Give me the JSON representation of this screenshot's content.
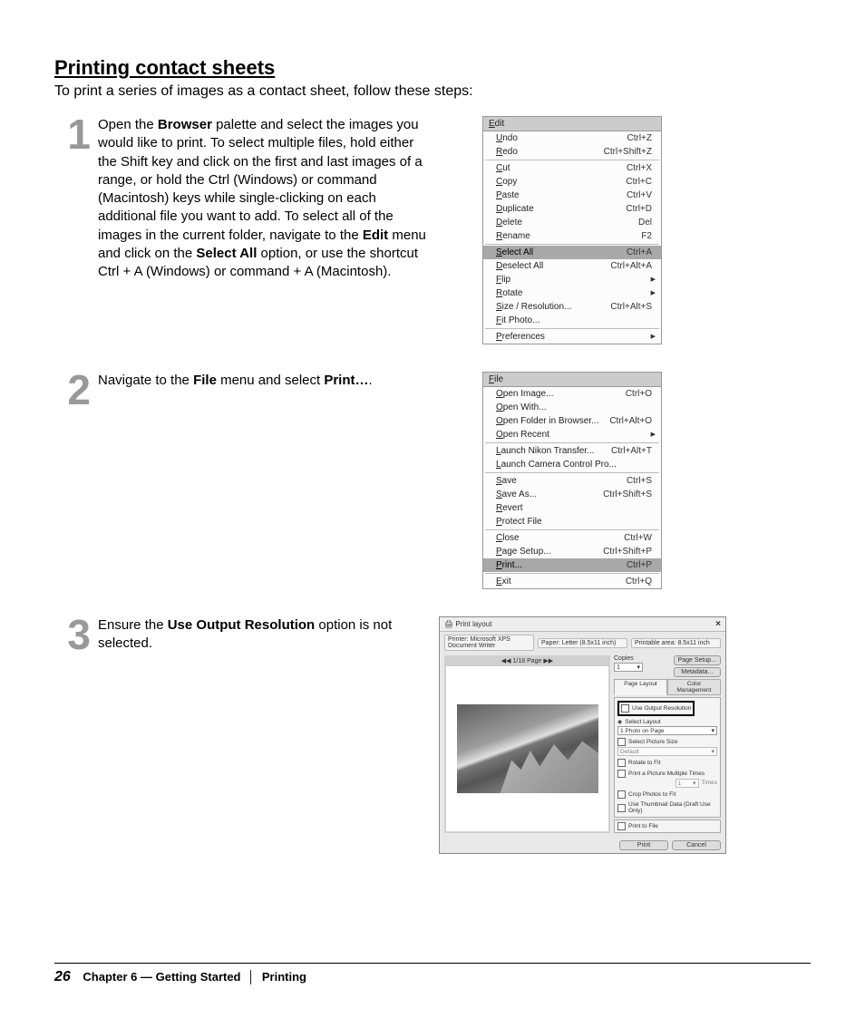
{
  "heading": "Printing contact sheets",
  "intro": "To print a series of images as a contact sheet, follow these steps:",
  "steps": {
    "s1": {
      "num": "1",
      "t1": "Open the ",
      "b1": "Browser",
      "t2": " palette and select the images you would like to print. To select multiple files, hold either the Shift key and click on the first and last images of a range, or hold the Ctrl (Windows) or command (Macintosh) keys while single-clicking on each additional file you want to add. To select all of the images in the current folder, navigate to the ",
      "b2": "Edit",
      "t3": " menu and click on the ",
      "b3": "Select All",
      "t4": " option, or use the shortcut Ctrl + A (Windows) or command + A (Macintosh)."
    },
    "s2": {
      "num": "2",
      "t1": "Navigate to the ",
      "b1": "File",
      "t2": " menu and select ",
      "b2": "Print…",
      "t3": "."
    },
    "s3": {
      "num": "3",
      "t1": "Ensure the ",
      "b1": "Use Output Resolution",
      "t2": " option is not selected."
    }
  },
  "editMenu": {
    "title": "Edit",
    "items": [
      {
        "l": "Undo",
        "s": "Ctrl+Z"
      },
      {
        "l": "Redo",
        "s": "Ctrl+Shift+Z"
      },
      {
        "sep": true
      },
      {
        "l": "Cut",
        "s": "Ctrl+X"
      },
      {
        "l": "Copy",
        "s": "Ctrl+C"
      },
      {
        "l": "Paste",
        "s": "Ctrl+V"
      },
      {
        "l": "Duplicate",
        "s": "Ctrl+D"
      },
      {
        "l": "Delete",
        "s": "Del"
      },
      {
        "l": "Rename",
        "s": "F2"
      },
      {
        "sep": true
      },
      {
        "l": "Select All",
        "s": "Ctrl+A",
        "hl": true
      },
      {
        "l": "Deselect All",
        "s": "Ctrl+Alt+A"
      },
      {
        "l": "Flip",
        "sub": true
      },
      {
        "l": "Rotate",
        "sub": true
      },
      {
        "l": "Size / Resolution...",
        "s": "Ctrl+Alt+S"
      },
      {
        "l": "Fit Photo..."
      },
      {
        "sep": true
      },
      {
        "l": "Preferences",
        "sub": true
      }
    ]
  },
  "fileMenu": {
    "title": "File",
    "items": [
      {
        "l": "Open Image...",
        "s": "Ctrl+O"
      },
      {
        "l": "Open With..."
      },
      {
        "l": "Open Folder in Browser...",
        "s": "Ctrl+Alt+O"
      },
      {
        "l": "Open Recent",
        "sub": true
      },
      {
        "sep": true
      },
      {
        "l": "Launch Nikon Transfer...",
        "s": "Ctrl+Alt+T"
      },
      {
        "l": "Launch Camera Control Pro..."
      },
      {
        "sep": true
      },
      {
        "l": "Save",
        "s": "Ctrl+S"
      },
      {
        "l": "Save As...",
        "s": "Ctrl+Shift+S"
      },
      {
        "l": "Revert"
      },
      {
        "l": "Protect File"
      },
      {
        "sep": true
      },
      {
        "l": "Close",
        "s": "Ctrl+W"
      },
      {
        "l": "Page Setup...",
        "s": "Ctrl+Shift+P"
      },
      {
        "l": "Print...",
        "s": "Ctrl+P",
        "hl": true
      },
      {
        "sep": true
      },
      {
        "l": "Exit",
        "s": "Ctrl+Q"
      }
    ]
  },
  "dialog": {
    "title": "Print layout",
    "printer": "Printer: Microsoft XPS Document Writer",
    "paper": "Paper: Letter (8.5x11 inch)",
    "printable": "Printable area: 8.5x11 inch",
    "pagectl": "1/18 Page",
    "copies_lbl": "Copies",
    "copies": "1",
    "btn_pagesetup": "Page Setup...",
    "btn_metadata": "Metadata...",
    "tab1": "Page Layout",
    "tab2": "Color Management",
    "useOutput": "Use Output Resolution",
    "selLayout": "Select Layout",
    "layoutOpt": "1 Photo on Page",
    "selSize": "Select Picture Size",
    "sizeOpt": "Default",
    "rotate": "Rotate to Fit",
    "multi": "Print a Picture Multiple Times",
    "timesVal": "1",
    "times": "Times",
    "crop": "Crop Photos to Fit",
    "thumb": "Use Thumbnail Data (Draft Use Only)",
    "tofile": "Print to File",
    "btn_print": "Print",
    "btn_cancel": "Cancel"
  },
  "footer": {
    "page": "26",
    "chapter": "Chapter 6 — Getting Started",
    "section": "Printing"
  }
}
